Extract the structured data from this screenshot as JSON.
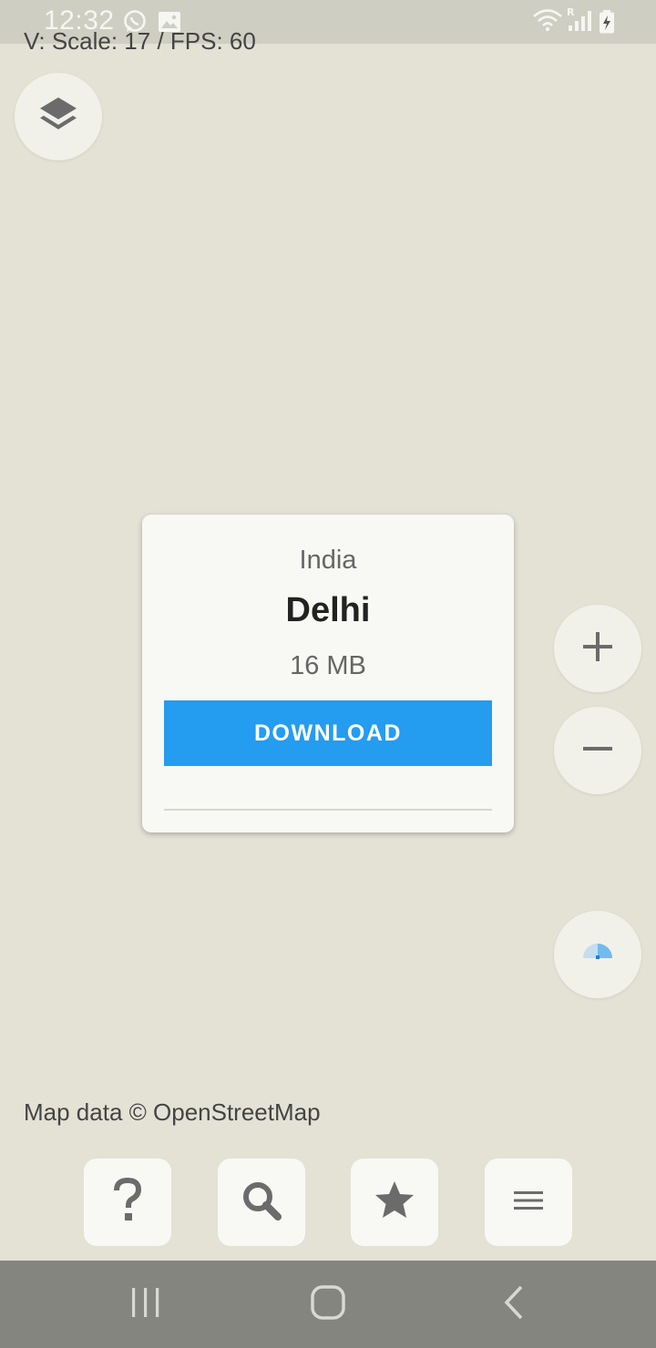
{
  "status_bar": {
    "time": "12:32",
    "icons": [
      "whatsapp-icon",
      "gallery-icon",
      "wifi-icon",
      "roaming-signal-icon",
      "battery-charging-icon"
    ]
  },
  "debug": {
    "text": "V: Scale: 17 / FPS: 60"
  },
  "map_controls": {
    "layers_icon": "layers-icon",
    "zoom_in_icon": "plus-icon",
    "zoom_out_icon": "minus-icon",
    "location_icon": "location-pending-icon"
  },
  "download_card": {
    "country": "India",
    "region": "Delhi",
    "size": "16 MB",
    "button_label": "DOWNLOAD",
    "progress": 0
  },
  "attribution": {
    "text": "Map data © OpenStreetMap"
  },
  "toolbar": {
    "items": [
      {
        "icon": "help-icon"
      },
      {
        "icon": "search-icon"
      },
      {
        "icon": "star-icon"
      },
      {
        "icon": "menu-icon"
      }
    ]
  },
  "colors": {
    "map_background": "#e3e2d5",
    "accent": "#249cf0",
    "button_surface": "#f1f1ea",
    "icon": "#6b6b6b"
  },
  "nav_bar": {
    "icons": [
      "recents-icon",
      "home-icon",
      "back-icon"
    ]
  }
}
